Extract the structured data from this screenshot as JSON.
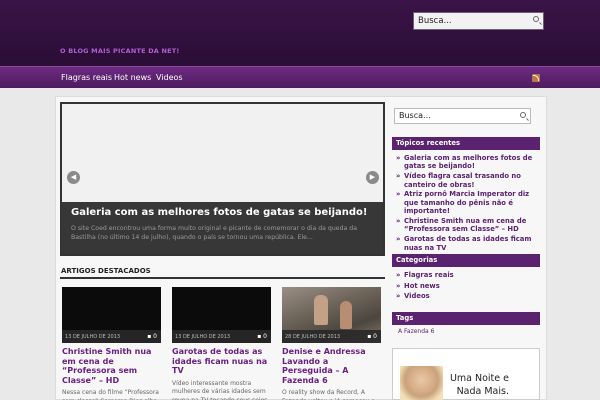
{
  "header": {
    "tagline": "O BLOG MAIS PICANTE DA NET!",
    "search_placeholder": "Busca..."
  },
  "nav": {
    "items": [
      "Flagras reais",
      "Hot news",
      "Videos"
    ],
    "rss_icon": "rss-icon"
  },
  "slider": {
    "title": "Galeria com as melhores fotos de gatas se beijando!",
    "excerpt": "O site Coed encontrou uma forma muito original e picante de comemorar o dia da queda da Bastilha (no último 14 de julho), quando o país se tornou uma república. Ele...",
    "prev_icon": "chevron-left-icon",
    "next_icon": "chevron-right-icon"
  },
  "featured": {
    "heading": "ARTIGOS DESTACADOS",
    "cards": [
      {
        "date": "13 DE JULHO DE 2013",
        "comments": "0",
        "title": "Christine Smith nua em cena de “Professora sem Classe” – HD",
        "excerpt": "Nessa cena do filme “Professora sem classe” Cameron Dias olha os seios"
      },
      {
        "date": "13 DE JULHO DE 2013",
        "comments": "0",
        "title": "Garotas de todas as idades ficam nuas na TV",
        "excerpt": "Vídeo interessante mostra mulheres de várias idades sem roupa na TV tocando seus seios. Fica meio obvio"
      },
      {
        "date": "28 DE JULHO DE 2013",
        "comments": "0",
        "title": "Denise e Andressa Lavando a Perseguida – A Fazenda 6",
        "excerpt": "O reality show da Record, A Fazenda voltou e já começou a pipocar na"
      }
    ]
  },
  "sidebar": {
    "search_placeholder": "Busca...",
    "recent_title": "Tópicos recentes",
    "recent": [
      "Galeria com as melhores fotos de gatas se beijando!",
      "Vídeo flagra casal trasando no canteiro de obras!",
      "Atriz pornô Marcia Imperator diz que tamanho do pênis não é importante!",
      "Christine Smith nua em cena de “Professora sem Classe” – HD",
      "Garotas de todas as idades ficam nuas na TV"
    ],
    "categories_title": "Categorias",
    "categories": [
      "Flagras reais",
      "Hot news",
      "Videos"
    ],
    "tags_title": "Tags",
    "tags": [
      "A Fazenda 6"
    ],
    "ad_text": "Uma Noite e Nada Mais."
  }
}
